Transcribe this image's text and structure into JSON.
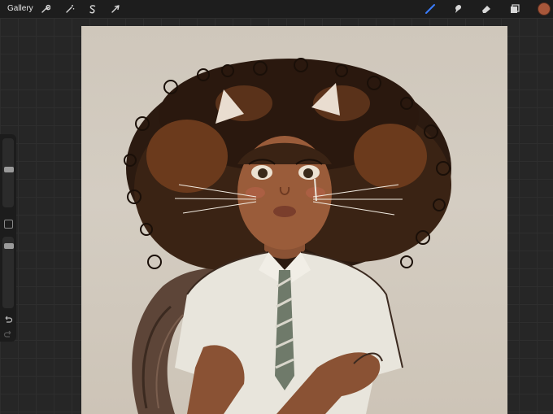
{
  "topbar": {
    "gallery_label": "Gallery",
    "left_tools": [
      "wrench-icon",
      "magic-wand-icon",
      "selection-icon",
      "transform-arrow-icon"
    ],
    "right_tools": [
      "brush-icon",
      "smudge-icon",
      "eraser-icon",
      "layers-icon"
    ],
    "active_tool": "brush-icon",
    "current_color": "#a8573a"
  },
  "sidebar": {
    "brush_size_level": 0.55,
    "opacity_level": 0.9,
    "undo_icon": "undo-icon",
    "redo_icon": "redo-icon"
  },
  "canvas": {
    "artwork_subject": "painting"
  }
}
